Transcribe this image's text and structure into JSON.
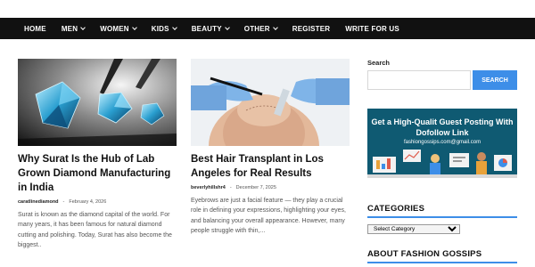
{
  "nav": {
    "items": [
      {
        "label": "HOME",
        "dropdown": false
      },
      {
        "label": "MEN",
        "dropdown": true
      },
      {
        "label": "WOMEN",
        "dropdown": true
      },
      {
        "label": "KIDS",
        "dropdown": true
      },
      {
        "label": "BEAUTY",
        "dropdown": true
      },
      {
        "label": "OTHER",
        "dropdown": true
      },
      {
        "label": "REGISTER",
        "dropdown": false
      },
      {
        "label": "WRITE FOR US",
        "dropdown": false
      }
    ]
  },
  "posts": [
    {
      "title": "Why Surat Is the Hub of Lab Grown Diamond Manufacturing in India",
      "author": "caratlinediamond",
      "date": "February 4, 2026",
      "excerpt": "Surat is known as the diamond capital of the world. For many years, it has been famous for natural diamond cutting and polishing. Today, Surat has also become the biggest..",
      "image": "diamonds-photo"
    },
    {
      "title": "Best Hair Transplant in Los Angeles for Real Results",
      "author": "beverlyhillshr4",
      "date": "December 7, 2025",
      "excerpt": "Eyebrows are just a facial feature — they play a crucial role in defining your expressions, highlighting your eyes, and balancing your overall appearance. However, many people struggle with thin,...",
      "image": "hair-transplant-photo"
    }
  ],
  "sidebar": {
    "search_label": "Search",
    "search_value": "",
    "search_button": "SEARCH",
    "banner": {
      "title": "Get a High-Qualit Guest Posting With Dofollow Link",
      "email": "fashiongossips.com@gmail.com"
    },
    "categories_title": "CATEGORIES",
    "categories_select": "Select Category",
    "about_title": "ABOUT FASHION GOSSIPS"
  },
  "colors": {
    "nav_bg": "#111111",
    "accent": "#3d8ee8",
    "banner_bg": "#0f5a72"
  }
}
